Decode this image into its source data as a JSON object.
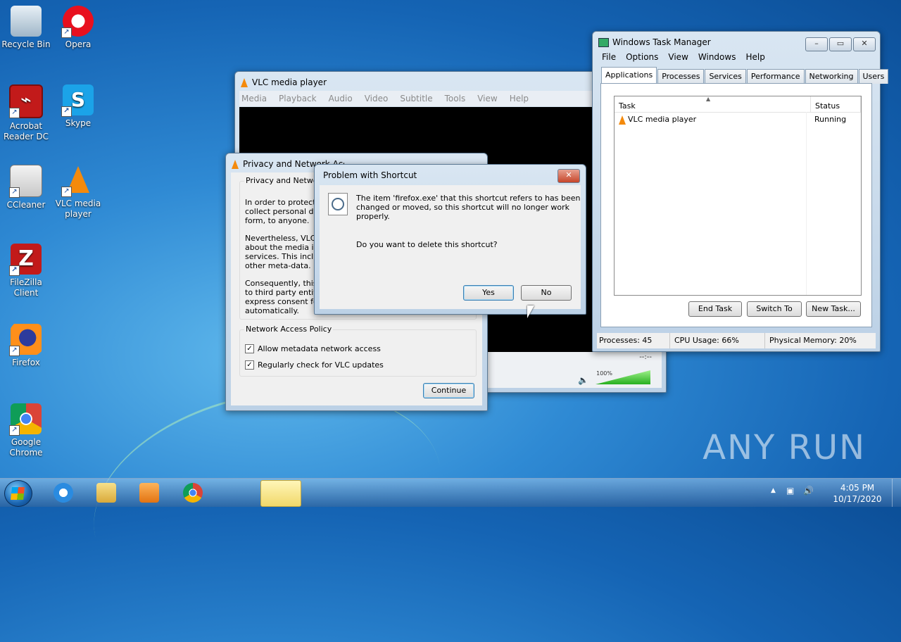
{
  "desktop": {
    "icons": [
      {
        "label": "Recycle Bin",
        "icon": "recycle-bin-icon"
      },
      {
        "label": "Opera",
        "icon": "opera-icon"
      },
      {
        "label": "Acrobat Reader DC",
        "icon": "acrobat-icon"
      },
      {
        "label": "Skype",
        "icon": "skype-icon"
      },
      {
        "label": "CCleaner",
        "icon": "ccleaner-icon"
      },
      {
        "label": "VLC media player",
        "icon": "vlc-icon"
      },
      {
        "label": "FileZilla Client",
        "icon": "filezilla-icon"
      },
      {
        "label": "Firefox",
        "icon": "firefox-icon"
      },
      {
        "label": "Google Chrome",
        "icon": "chrome-icon"
      }
    ],
    "watermark": "ANY RUN"
  },
  "vlc": {
    "title": "VLC media player",
    "menu": [
      "Media",
      "Playback",
      "Audio",
      "Video",
      "Subtitle",
      "Tools",
      "View",
      "Help"
    ],
    "time": "--:--",
    "volume_label": "100%",
    "volume_level": 1.0
  },
  "privacy": {
    "title": "Privacy and Network Access Policy",
    "group1_title": "Privacy and Network Access Policy",
    "p1": [
      "In order to protect y",
      "collect personal data",
      "form, to anyone."
    ],
    "p2": [
      "Nevertheless, VLC is",
      "about the media in y",
      "services. This include",
      "other meta-data."
    ],
    "p3": [
      "Consequently, this m",
      "to third party entitie",
      "express consent for",
      "automatically."
    ],
    "group2_title": "Network Access Policy",
    "check1": "Allow metadata network access",
    "check2": "Regularly check for VLC updates",
    "continue": "Continue"
  },
  "problem": {
    "title": "Problem with Shortcut",
    "message": "The item 'firefox.exe' that this shortcut refers to has been changed or moved, so this shortcut will no longer work properly.",
    "question": "Do you want to delete this shortcut?",
    "yes": "Yes",
    "no": "No"
  },
  "taskmgr": {
    "title": "Windows Task Manager",
    "menu": [
      "File",
      "Options",
      "View",
      "Windows",
      "Help"
    ],
    "tabs": [
      "Applications",
      "Processes",
      "Services",
      "Performance",
      "Networking",
      "Users"
    ],
    "col_task": "Task",
    "col_status": "Status",
    "rows": [
      {
        "task": "VLC media player",
        "status": "Running"
      }
    ],
    "end_task": "End Task",
    "switch_to": "Switch To",
    "new_task": "New Task...",
    "status_processes": "Processes: 45",
    "status_cpu": "CPU Usage: 66%",
    "status_mem": "Physical Memory: 20%"
  },
  "taskbar": {
    "time": "4:05 PM",
    "date": "10/17/2020"
  }
}
